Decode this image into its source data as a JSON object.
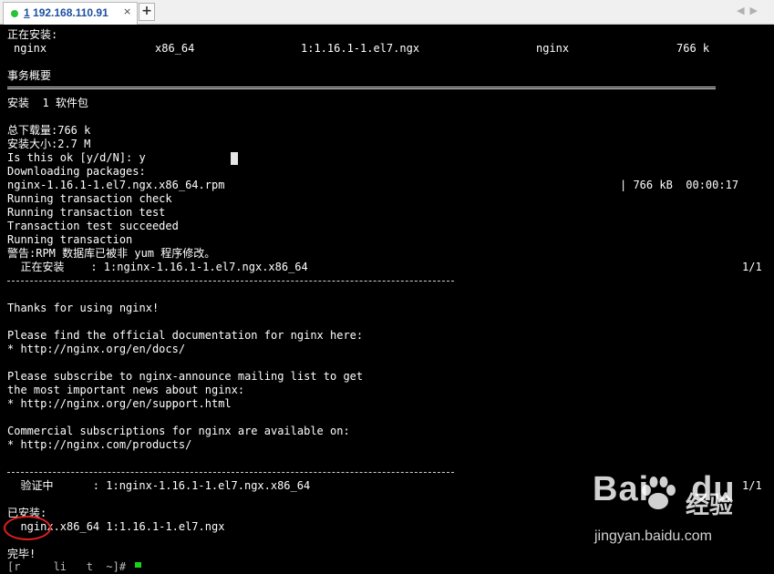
{
  "tab": {
    "number": "1",
    "host": "192.168.110.91",
    "close": "×",
    "add": "+"
  },
  "nav": {
    "prev": "◀",
    "next": "▶"
  },
  "terminal": {
    "installing_header": "正在安装:",
    "pkg_row": {
      "name": "nginx",
      "arch": "x86_64",
      "version": "1:1.16.1-1.el7.ngx",
      "repo": "nginx",
      "size": "766 k"
    },
    "summary_header": "事务概要",
    "install_count": "安装  1 软件包",
    "total_download": "总下载量:766 k",
    "install_size": "安装大小:2.7 M",
    "confirm_prompt": "Is this ok [y/d/N]: y",
    "downloading": "Downloading packages:",
    "rpm_file": "nginx-1.16.1-1.el7.ngx.x86_64.rpm",
    "rpm_progress": "| 766 kB  00:00:17",
    "tx_check": "Running transaction check",
    "tx_test": "Running transaction test",
    "tx_success": "Transaction test succeeded",
    "tx_running": "Running transaction",
    "rpm_warning": "警告:RPM 数据库已被非 yum 程序修改。",
    "installing_line": "  正在安装    : 1:nginx-1.16.1-1.el7.ngx.x86_64",
    "installing_count": "1/1",
    "thanks": "Thanks for using nginx!",
    "docs_intro": "Please find the official documentation for nginx here:",
    "docs_url": "* http://nginx.org/en/docs/",
    "subscribe_1": "Please subscribe to nginx-announce mailing list to get",
    "subscribe_2": "the most important news about nginx:",
    "support_url": "* http://nginx.org/en/support.html",
    "commercial": "Commercial subscriptions for nginx are available on:",
    "products_url": "* http://nginx.com/products/",
    "verify_line": "  验证中      : 1:nginx-1.16.1-1.el7.ngx.x86_64",
    "verify_count": "1/1",
    "installed_header": "已安装:",
    "installed_pkg": "  nginx.x86_64 1:1.16.1-1.el7.ngx",
    "complete": "完毕!",
    "prompt_partial": "[r     li   t  ~]# "
  },
  "watermark": {
    "logo": "Bai",
    "logo_suffix": "du",
    "label": "经验",
    "url": "jingyan.baidu.com"
  },
  "colors": {
    "tab_text": "#1a4fa0",
    "status_dot": "#27c23a",
    "cursor": "#19d219",
    "highlight_circle": "#e02020"
  }
}
